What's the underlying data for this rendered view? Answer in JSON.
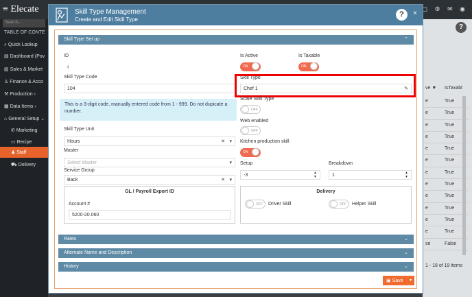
{
  "app": {
    "logo_text": "Elecate",
    "top_icons": "◻ ⚙ ✉ ◉"
  },
  "sidebar": {
    "search_placeholder": "Search...",
    "toc_label": "TABLE OF CONTE",
    "items": [
      {
        "icon": "⌕",
        "label": "Quick Lookup"
      },
      {
        "icon": "▤",
        "label": "Dashboard (Pov"
      },
      {
        "icon": "▥",
        "label": "Sales & Market"
      },
      {
        "icon": "♙",
        "label": "Finance & Acco"
      },
      {
        "icon": "⚒",
        "label": "Production  ›"
      },
      {
        "icon": "▦",
        "label": "Data Items  ›"
      },
      {
        "icon": "⌂",
        "label": "General Setup ⌄"
      },
      {
        "icon": "✆",
        "label": "Marketing"
      },
      {
        "icon": "▭",
        "label": "Recipe"
      },
      {
        "icon": "♟",
        "label": "Staff"
      },
      {
        "icon": "⛟",
        "label": "Delivery"
      }
    ]
  },
  "bg_table": {
    "headers": [
      "ve ▼",
      "IsTaxabl"
    ],
    "rows": [
      [
        "e",
        "True"
      ],
      [
        "e",
        "True"
      ],
      [
        "e",
        "True"
      ],
      [
        "e",
        "True"
      ],
      [
        "e",
        "True"
      ],
      [
        "e",
        "True"
      ],
      [
        "e",
        "True"
      ],
      [
        "e",
        "True"
      ],
      [
        "e",
        "True"
      ],
      [
        "e",
        "True"
      ],
      [
        "e",
        "True"
      ],
      [
        "e",
        "True"
      ],
      [
        "se",
        "False"
      ]
    ],
    "pager": "1 - 18 of 19 items"
  },
  "modal": {
    "title": "Skill Type Management",
    "subtitle": "Create and Edit Skill Type",
    "help": "?",
    "close": "×"
  },
  "setup": {
    "heading": "Skill Type Set up",
    "id_label": "ID",
    "id_value": "4",
    "code_label": "Skill Type Code",
    "code_value": "104",
    "info_text": "This is a 3-digit code, manually entered code from 1 - 999. Do not dupicate a number.",
    "unit_label": "Skill Type Unit",
    "unit_value": "Hours",
    "master_label": "Master",
    "master_placeholder": "Select Master",
    "group_label": "Service Group",
    "group_value": "Back",
    "active_label": "Is Active",
    "taxable_label": "Is Taxable",
    "type_label": "Skill Type",
    "type_value": "Chef 1",
    "scale_label": "Scale Skill Type",
    "web_label": "Web enabled",
    "kitchen_label": "Kitchen production skill",
    "setup_label": "Setup",
    "setup_value": "-3",
    "breakdown_label": "Breakdown",
    "breakdown_value": "1",
    "on_text": "ON",
    "off_text": "OFF"
  },
  "gl": {
    "title": "GL / Payroll Export ID",
    "account_label": "Account #",
    "account_value": "5200-20.060"
  },
  "delivery": {
    "title": "Delivery",
    "driver_label": "Driver Skill",
    "helper_label": "Helper Skill"
  },
  "sections": {
    "rates": "Rates",
    "alternate": "Alternate Name and Description",
    "history": "History"
  },
  "save_label": "Save"
}
